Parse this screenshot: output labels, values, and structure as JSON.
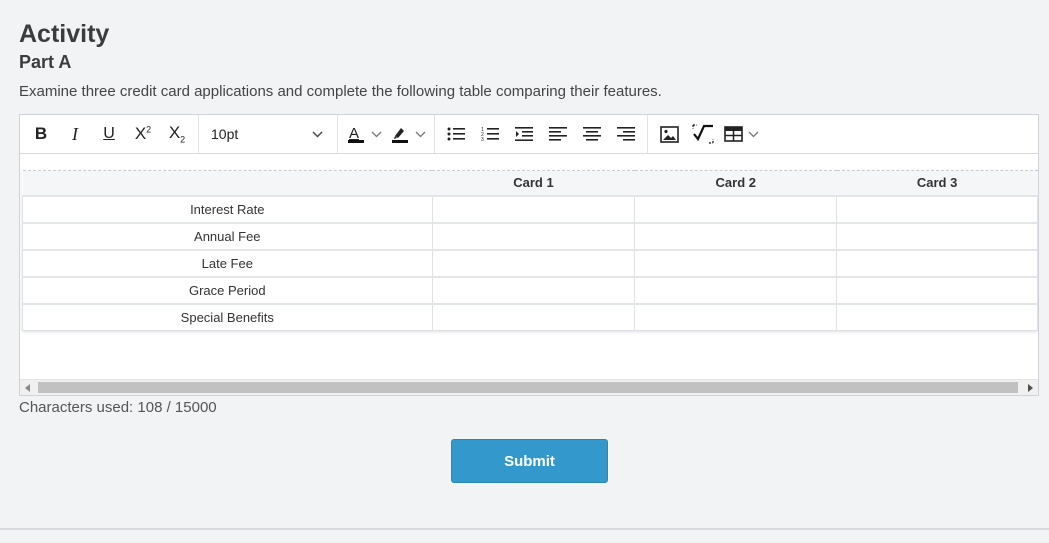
{
  "header": {
    "title": "Activity",
    "part": "Part A",
    "instructions": "Examine three credit card applications and complete the following table comparing their features."
  },
  "toolbar": {
    "bold_icon": "bold-icon",
    "italic_icon": "italic-icon",
    "underline_icon": "underline-icon",
    "superscript_icon": "superscript-icon",
    "subscript_icon": "subscript-icon",
    "font_size": "10pt",
    "text_color_icon": "text-color-icon",
    "highlight_icon": "highlight-icon",
    "bullet_list_icon": "bullet-list-icon",
    "numbered_list_icon": "numbered-list-icon",
    "indent_icon": "indent-icon",
    "align_left_icon": "align-left-icon",
    "align_center_icon": "align-center-icon",
    "align_right_icon": "align-right-icon",
    "image_icon": "image-icon",
    "equation_icon": "equation-icon",
    "table_icon": "table-icon"
  },
  "table": {
    "headers": [
      "",
      "Card 1",
      "Card 2",
      "Card 3"
    ],
    "rows": [
      [
        "Interest Rate",
        "",
        "",
        ""
      ],
      [
        "Annual Fee",
        "",
        "",
        ""
      ],
      [
        "Late Fee",
        "",
        "",
        ""
      ],
      [
        "Grace Period",
        "",
        "",
        ""
      ],
      [
        "Special Benefits",
        "",
        "",
        ""
      ]
    ]
  },
  "footer": {
    "char_count": "Characters used: 108 / 15000",
    "submit_label": "Submit"
  },
  "colors": {
    "accent": "#3399cc",
    "background": "#f2f3f5"
  }
}
